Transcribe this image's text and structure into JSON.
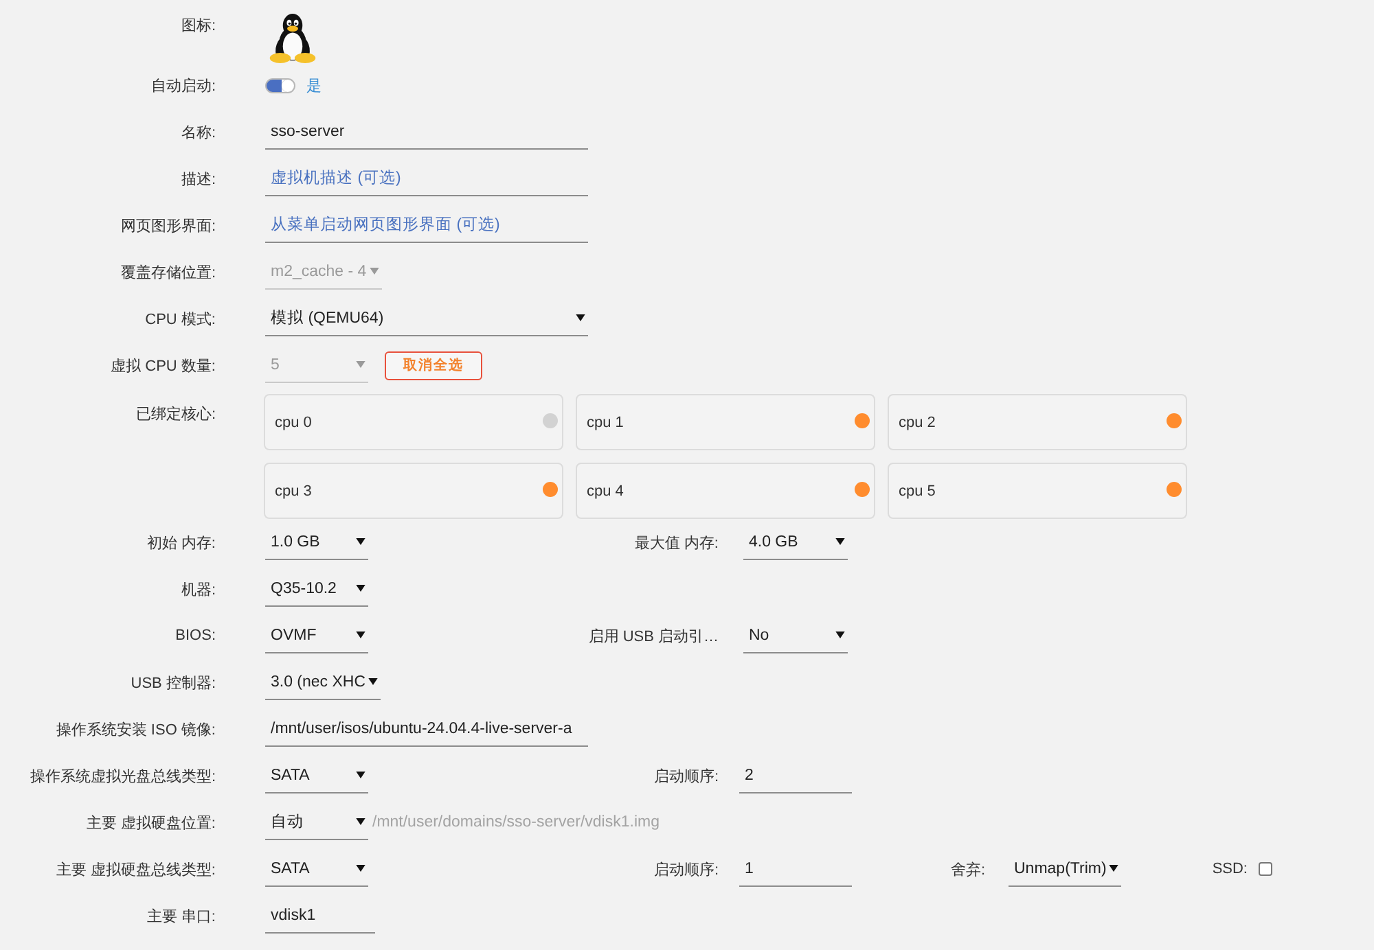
{
  "form": {
    "rows": [
      {
        "kind": "icon",
        "label": "图标:"
      },
      {
        "kind": "toggle",
        "label": "自动启动:",
        "on": true,
        "text": "是"
      },
      {
        "kind": "text",
        "label": "名称:",
        "value": "sso-server"
      },
      {
        "kind": "text",
        "label": "描述:",
        "placeholder": "虚拟机描述 (可选)"
      },
      {
        "kind": "text",
        "label": "网页图形界面:",
        "placeholder": "从菜单启动网页图形界面 (可选)"
      },
      {
        "kind": "select",
        "label": "覆盖存储位置:",
        "value": "m2_cache - 4",
        "disabled": true
      },
      {
        "kind": "wideselect",
        "label": "CPU 模式:",
        "value": "模拟 (QEMU64)",
        "disabled": false
      },
      {
        "kind": "select",
        "label": "虚拟 CPU 数量:",
        "value": "5",
        "disabled": true,
        "button": "取消全选"
      },
      {
        "kind": "cores",
        "label": "已绑定核心:",
        "cores": [
          {
            "name": "cpu 0",
            "checked": false
          },
          {
            "name": "cpu 1",
            "checked": true
          },
          {
            "name": "cpu 2",
            "checked": true
          },
          {
            "name": "cpu 3",
            "checked": true
          },
          {
            "name": "cpu 4",
            "checked": true
          },
          {
            "name": "cpu 5",
            "checked": true
          }
        ]
      },
      {
        "kind": "select",
        "label": "初始 内存:",
        "value": "1.0 GB",
        "disabled": false,
        "extras": [
          {
            "kind": "select",
            "label": "最大值 内存:",
            "value": "4.0 GB",
            "disabled": false
          }
        ]
      },
      {
        "kind": "select",
        "label": "机器:",
        "value": "Q35-10.2",
        "disabled": false
      },
      {
        "kind": "select",
        "label": "BIOS:",
        "value": "OVMF",
        "disabled": false,
        "extras": [
          {
            "kind": "select",
            "label": "启用 USB 启动引…",
            "value": "No",
            "disabled": false
          }
        ]
      },
      {
        "kind": "select",
        "label": "USB 控制器:",
        "value": "3.0 (nec XHC",
        "disabled": false
      },
      {
        "kind": "text",
        "label": "操作系统安装 ISO 镜像:",
        "value": "/mnt/user/isos/ubuntu-24.04.4-live-server-a"
      },
      {
        "kind": "select",
        "label": "操作系统虚拟光盘总线类型:",
        "value": "SATA",
        "disabled": false,
        "extras": [
          {
            "kind": "text",
            "label": "启动顺序:",
            "value": "2"
          }
        ]
      },
      {
        "kind": "select",
        "label": "主要 虚拟硬盘位置:",
        "value": "自动",
        "disabled": false,
        "note": "/mnt/user/domains/sso-server/vdisk1.img"
      },
      {
        "kind": "select",
        "label": "主要 虚拟硬盘总线类型:",
        "value": "SATA",
        "disabled": false,
        "extras": [
          {
            "kind": "text",
            "label": "启动顺序:",
            "value": "1"
          },
          {
            "kind": "select",
            "label": "舍弃:",
            "value": "Unmap(Trim)",
            "disabled": false
          },
          {
            "kind": "checkbox",
            "label": "SSD:",
            "checked": false
          }
        ]
      },
      {
        "kind": "shorttext",
        "label": "主要 串口:",
        "value": "vdisk1"
      }
    ]
  }
}
